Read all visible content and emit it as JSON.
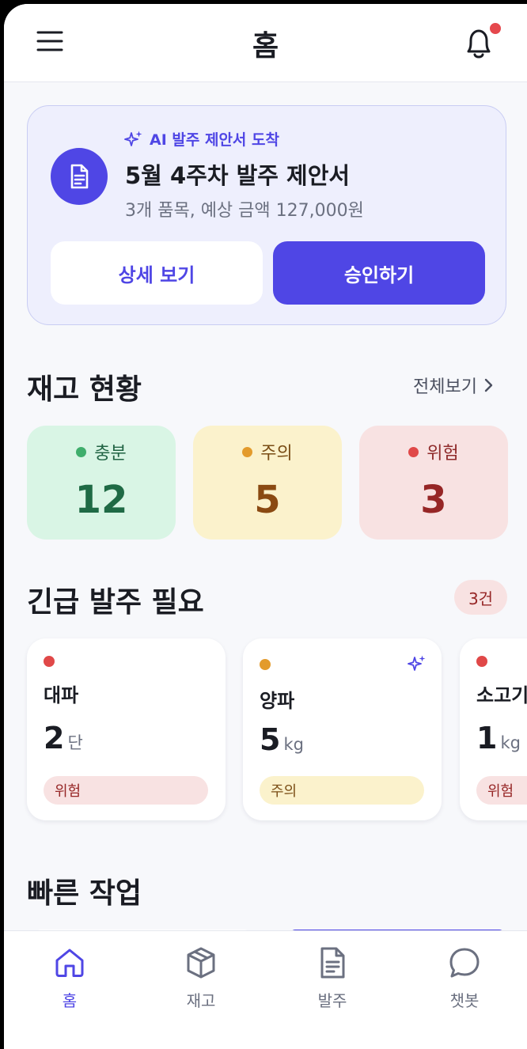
{
  "header": {
    "title": "홈"
  },
  "proposal": {
    "tag": "AI 발주 제안서 도착",
    "title": "5월 4주차 발주 제안서",
    "subtitle": "3개 품목, 예상 금액 127,000원",
    "detail_label": "상세 보기",
    "approve_label": "승인하기"
  },
  "stock": {
    "title": "재고 현황",
    "see_all": "전체보기",
    "items": [
      {
        "label": "충분",
        "count": "12"
      },
      {
        "label": "주의",
        "count": "5"
      },
      {
        "label": "위험",
        "count": "3"
      }
    ]
  },
  "urgent": {
    "title": "긴급 발주 필요",
    "badge": "3건",
    "items": [
      {
        "name": "대파",
        "qty": "2",
        "unit": "단",
        "status": "위험"
      },
      {
        "name": "양파",
        "qty": "5",
        "unit": "kg",
        "status": "주의"
      },
      {
        "name": "소고기",
        "qty": "1",
        "unit": "kg",
        "status": "위험"
      }
    ]
  },
  "quick": {
    "title": "빠른 작업"
  },
  "nav": {
    "items": [
      {
        "label": "홈",
        "icon": "home-icon"
      },
      {
        "label": "재고",
        "icon": "box-icon"
      },
      {
        "label": "발주",
        "icon": "document-icon"
      },
      {
        "label": "챗봇",
        "icon": "chat-icon"
      }
    ]
  },
  "colors": {
    "accent": "#4f46e5",
    "ok": "#3fae6c",
    "warn": "#e39b2c",
    "danger": "#e04848"
  }
}
